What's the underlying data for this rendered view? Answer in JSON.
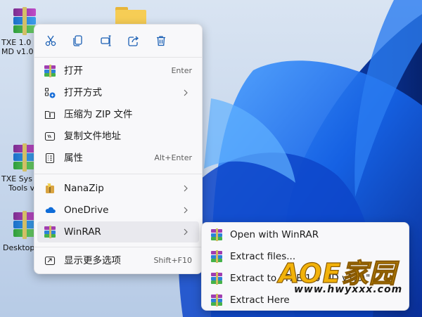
{
  "desktop": {
    "icons": [
      {
        "label_lines": [
          "TXE 1.0",
          "MD v1.0"
        ]
      },
      {
        "label_lines": [
          "TXE Sys",
          "Tools v"
        ]
      },
      {
        "label_lines": [
          "Desktop"
        ]
      }
    ]
  },
  "toolbar": {
    "icons": [
      "cut-icon",
      "copy-icon",
      "rename-icon",
      "share-icon",
      "delete-icon"
    ]
  },
  "menu": {
    "items": [
      {
        "label": "打开",
        "shortcut": "Enter",
        "icon": "winrar-icon"
      },
      {
        "label": "打开方式",
        "shortcut": "",
        "icon": "open-with-icon",
        "submenu": true
      },
      {
        "label": "压缩为 ZIP 文件",
        "shortcut": "",
        "icon": "zip-folder-icon"
      },
      {
        "label": "复制文件地址",
        "shortcut": "",
        "icon": "copy-path-icon"
      },
      {
        "label": "属性",
        "shortcut": "Alt+Enter",
        "icon": "properties-icon"
      },
      {
        "label": "NanaZip",
        "shortcut": "",
        "icon": "nanazip-icon",
        "submenu": true
      },
      {
        "label": "OneDrive",
        "shortcut": "",
        "icon": "onedrive-icon",
        "submenu": true
      },
      {
        "label": "WinRAR",
        "shortcut": "",
        "icon": "winrar-icon",
        "submenu": true
      },
      {
        "label": "显示更多选项",
        "shortcut": "Shift+F10",
        "icon": "show-more-icon"
      }
    ]
  },
  "submenu": {
    "items": [
      {
        "label": "Open with WinRAR"
      },
      {
        "label": "Extract files..."
      },
      {
        "label": "Extract to \"TXE 1.0 MD v1.0\\\""
      },
      {
        "label": "Extract Here"
      }
    ]
  },
  "watermark": {
    "title": "AOE家园",
    "url": "www.hwyxxx.com"
  },
  "colors": {
    "menu_bg": "#f8f8fa",
    "hover_bg": "#e9e9ee",
    "watermark": "#f2b20a"
  }
}
